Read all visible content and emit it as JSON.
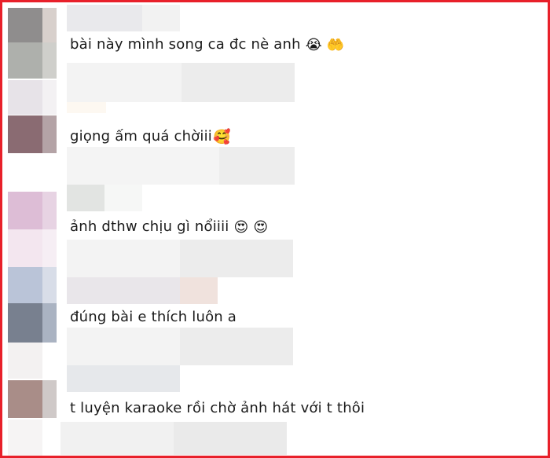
{
  "comments": [
    {
      "text": "bài này mình song ca đc nè anh",
      "emoji": "😭 🤲"
    },
    {
      "text": "giọng ấm quá chờiii",
      "emoji": "🥰"
    },
    {
      "text": "ảnh dthw chịu gì nổiiii",
      "emoji": "😍 😍"
    },
    {
      "text": "đúng bài e thích luôn a",
      "emoji": ""
    },
    {
      "text": "t luyện karaoke rồi chờ ảnh hát với t thôi",
      "emoji": ""
    }
  ],
  "colors": {
    "frame_border": "#e8202a",
    "text": "#1a1a1a",
    "background": "#ffffff"
  }
}
